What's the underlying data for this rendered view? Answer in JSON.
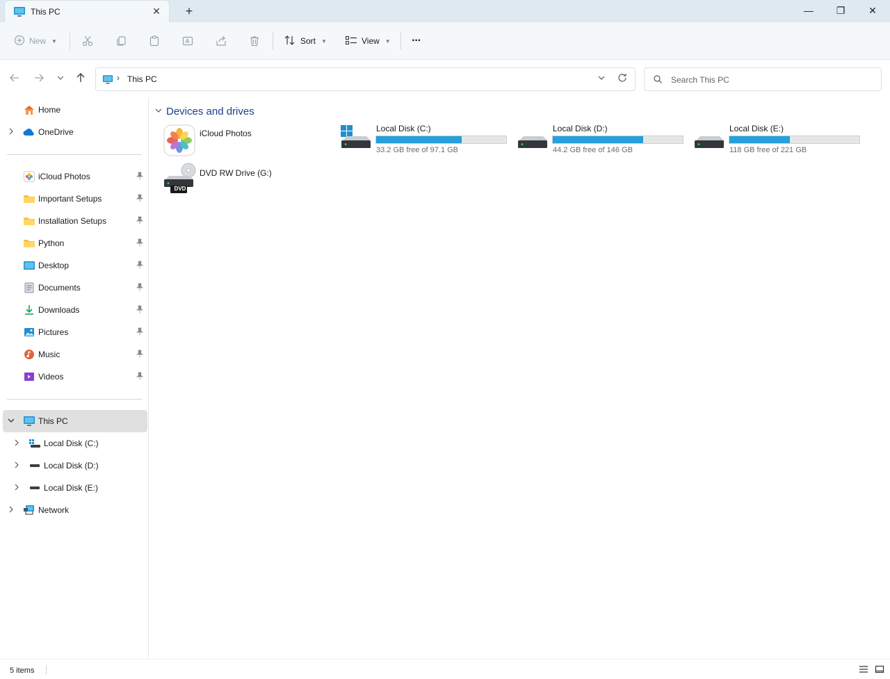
{
  "window": {
    "tab_title": "This PC",
    "tab_icon": "this-pc-icon",
    "new_tab_glyph": "+",
    "minimize_glyph": "—",
    "maximize_glyph": "❐",
    "close_glyph": "✕"
  },
  "toolbar": {
    "new_label": "New",
    "sort_label": "Sort",
    "view_label": "View",
    "more_glyph": "···",
    "disabled_actions": [
      "cut-icon",
      "copy-icon",
      "paste-icon",
      "rename-icon",
      "share-icon",
      "delete-icon"
    ]
  },
  "address_bar": {
    "path_separator": "›",
    "path": "This PC",
    "refresh_glyph": "↻",
    "dropdown_glyph": "⌄"
  },
  "search": {
    "placeholder": "Search This PC"
  },
  "sidebar": {
    "top_items": [
      {
        "label": "Home",
        "icon": "home-icon",
        "expandable": false
      },
      {
        "label": "OneDrive",
        "icon": "onedrive-icon",
        "expandable": true
      }
    ],
    "quick_access": [
      {
        "label": "iCloud Photos",
        "icon": "icloud-photos-icon",
        "pinned": true
      },
      {
        "label": "Important Setups",
        "icon": "folder-icon",
        "pinned": true
      },
      {
        "label": "Installation Setups",
        "icon": "folder-icon",
        "pinned": true
      },
      {
        "label": "Python",
        "icon": "folder-icon",
        "pinned": true
      },
      {
        "label": "Desktop",
        "icon": "desktop-icon",
        "pinned": true
      },
      {
        "label": "Documents",
        "icon": "documents-icon",
        "pinned": true
      },
      {
        "label": "Downloads",
        "icon": "downloads-icon",
        "pinned": true
      },
      {
        "label": "Pictures",
        "icon": "pictures-icon",
        "pinned": true
      },
      {
        "label": "Music",
        "icon": "music-icon",
        "pinned": true
      },
      {
        "label": "Videos",
        "icon": "videos-icon",
        "pinned": true
      }
    ],
    "this_pc": {
      "label": "This PC",
      "icon": "this-pc-icon",
      "expanded": true,
      "selected": true
    },
    "drives": [
      {
        "label": "Local Disk (C:)",
        "icon": "windows-drive-icon"
      },
      {
        "label": "Local Disk (D:)",
        "icon": "drive-icon"
      },
      {
        "label": "Local Disk (E:)",
        "icon": "drive-icon"
      }
    ],
    "network": {
      "label": "Network",
      "icon": "network-icon"
    }
  },
  "content": {
    "group_title": "Devices and drives",
    "items": [
      {
        "name": "iCloud Photos",
        "icon": "icloud-photos-icon"
      },
      {
        "name": "Local Disk (C:)",
        "icon": "windows-drive-icon",
        "free": "33.2 GB free of 97.1 GB",
        "used_fraction": 0.658
      },
      {
        "name": "Local Disk (D:)",
        "icon": "drive-icon",
        "free": "44.2 GB free of 146 GB",
        "used_fraction": 0.697
      },
      {
        "name": "Local Disk (E:)",
        "icon": "drive-icon",
        "free": "118 GB free of 221 GB",
        "used_fraction": 0.466
      },
      {
        "name": "DVD RW Drive (G:)",
        "icon": "dvd-drive-icon",
        "badge": "DVD"
      }
    ]
  },
  "status": {
    "item_count": "5 items"
  },
  "colors": {
    "accent": "#26a0da",
    "group_header": "#1e3c8c",
    "titlebar": "#dfe9f1",
    "commandbar": "#f4f8fb"
  }
}
